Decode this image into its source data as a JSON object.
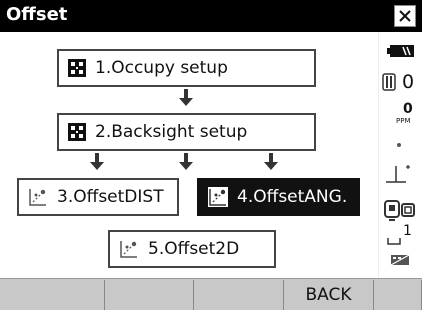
{
  "window": {
    "title": "Offset",
    "close_label": "×"
  },
  "menu": [
    {
      "label": "1.Occupy setup",
      "icon": "grid-icon",
      "selected": false
    },
    {
      "label": "2.Backsight setup",
      "icon": "grid-icon",
      "selected": false
    },
    {
      "label": "3.OffsetDIST",
      "icon": "offset-dist-icon",
      "selected": false
    },
    {
      "label": "4.OffsetANG.",
      "icon": "offset-ang-icon",
      "selected": true
    },
    {
      "label": "5.Offset2D",
      "icon": "offset-2d-icon",
      "selected": false
    }
  ],
  "status": {
    "prism_constant": "0",
    "ppm_value": "0",
    "ppm_unit": "PPM",
    "face_number": "1",
    "battery_icon": "battery-icon",
    "target_icon": "prism-icon",
    "tilt_icon": "tilt-icon",
    "mode_icon": "instrument-mode-icon",
    "input_icon": "keyboard-input-icon"
  },
  "softkeys": [
    "",
    "",
    "",
    "BACK",
    ""
  ],
  "colors": {
    "titlebar": "#000000",
    "selected_bg": "#111111",
    "softkey_bar": "#c8c8c8"
  }
}
